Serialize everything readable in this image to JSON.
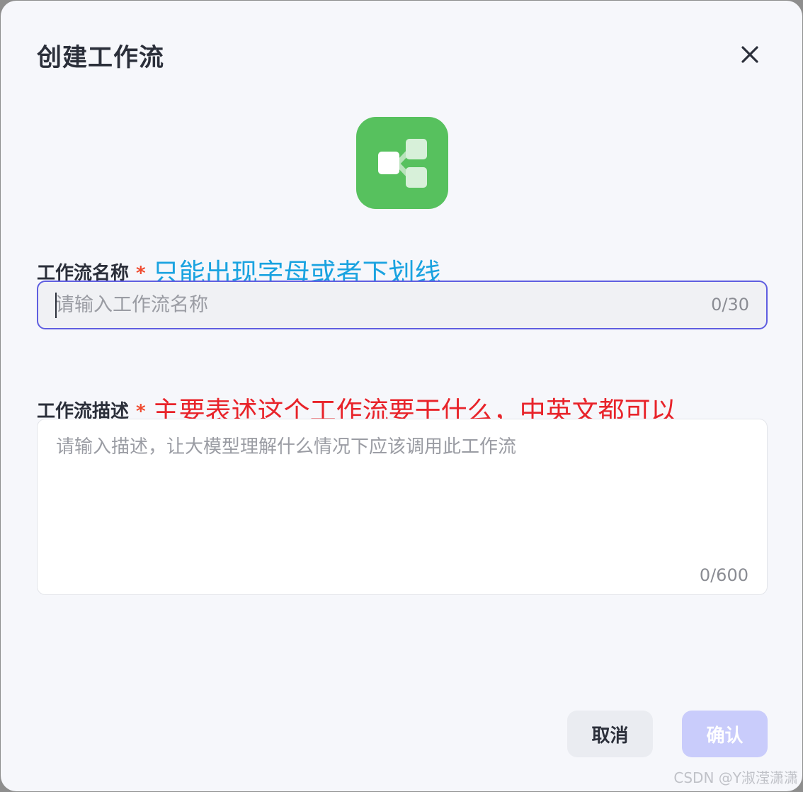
{
  "dialog": {
    "title": "创建工作流",
    "close_icon": "close-icon",
    "app_icon": "workflow-icon",
    "app_icon_color": "#57c15e"
  },
  "name_field": {
    "label": "工作流名称",
    "required_mark": "*",
    "annotation": "只能出现字母或者下划线",
    "annotation_color": "#1aa3e0",
    "value": "",
    "placeholder": "请输入工作流名称",
    "counter": "0/30"
  },
  "description_field": {
    "label": "工作流描述",
    "required_mark": "*",
    "annotation": "主要表述这个工作流要干什么，中英文都可以",
    "annotation_color": "#e8232a",
    "value": "",
    "placeholder": "请输入描述，让大模型理解什么情况下应该调用此工作流",
    "counter": "0/600"
  },
  "footer": {
    "cancel_label": "取消",
    "confirm_label": "确认"
  },
  "watermark": "CSDN @Y淑滢潇潇",
  "colors": {
    "accent": "#5f5ee0",
    "required": "#f04a2e",
    "confirm_disabled": "#c9ccfb"
  }
}
